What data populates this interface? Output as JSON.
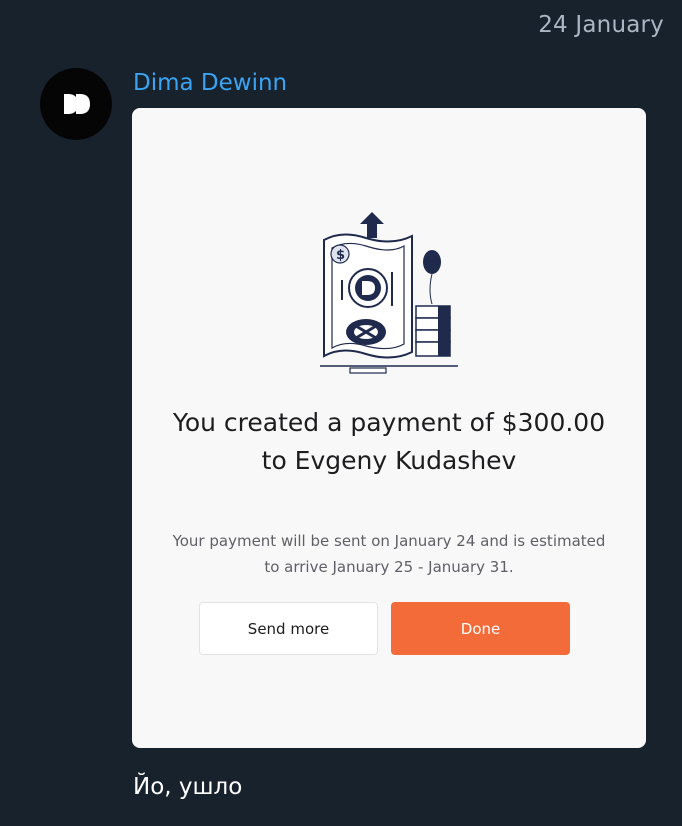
{
  "chat": {
    "date_label": "24 January",
    "sender_name": "Dima Dewinn",
    "caption": "Йо, ушло",
    "avatar_icon": "fast-forward-logo-icon"
  },
  "card": {
    "illustration_icon": "money-growth-illustration",
    "headline": "You created a payment of $300.00 to Evgeny Kudashev",
    "subtext": "Your payment will be sent on January 24 and is estimated to arrive January 25 - January 31.",
    "send_more_label": "Send more",
    "done_label": "Done"
  },
  "colors": {
    "background": "#18222d",
    "sender_name": "#3ba4f2",
    "card_background": "#f8f8f8",
    "primary_button": "#f26b38"
  }
}
